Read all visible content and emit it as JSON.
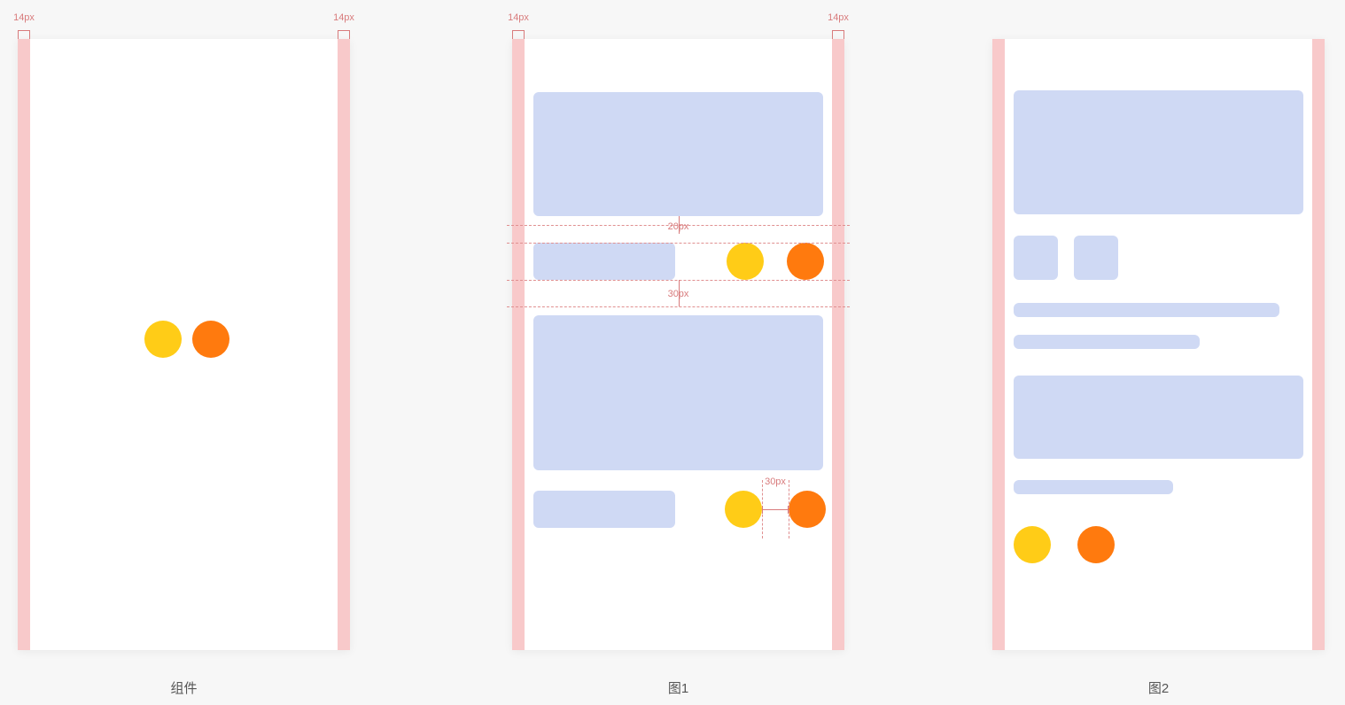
{
  "margin_px_label": "14px",
  "panels": {
    "p1": {
      "caption": "组件"
    },
    "p2": {
      "caption": "图1",
      "gap_top_label": "20px",
      "gap_bottom_label": "30px",
      "circle_gap_label": "30px"
    },
    "p3": {
      "caption": "图2"
    }
  }
}
